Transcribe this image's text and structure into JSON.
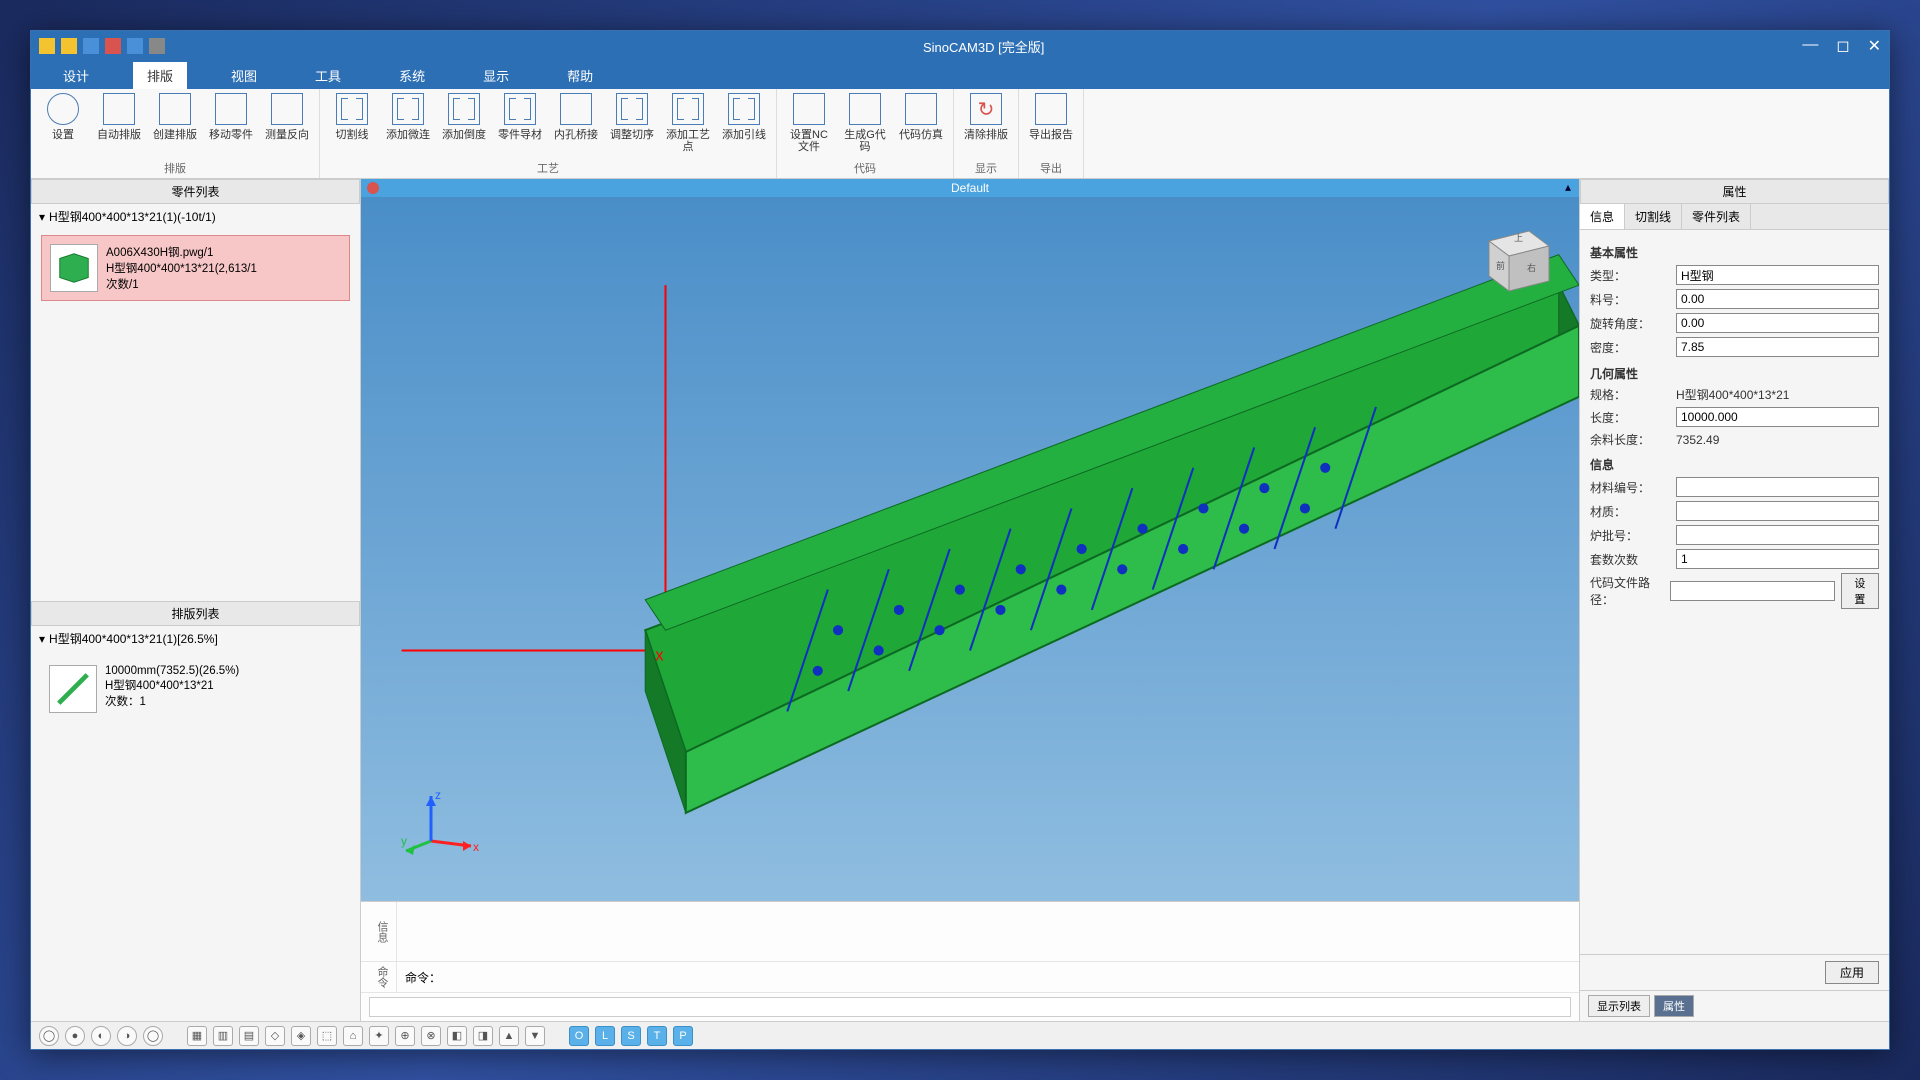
{
  "titlebar": {
    "title": "SinoCAM3D [完全版]"
  },
  "menu": {
    "tabs": [
      "设计",
      "排版",
      "视图",
      "工具",
      "系统",
      "显示",
      "帮助"
    ],
    "active": 1
  },
  "ribbon": {
    "groups": [
      {
        "label": "排版",
        "items": [
          "设置",
          "自动排版",
          "创建排版",
          "移动零件",
          "测量反向"
        ]
      },
      {
        "label": "工艺",
        "items": [
          "切割线",
          "添加微连",
          "添加倒度",
          "零件导材",
          "内孔桥接",
          "调整切序",
          "添加工艺点",
          "添加引线"
        ]
      },
      {
        "label": "代码",
        "items": [
          "设置NC文件",
          "生成G代码",
          "代码仿真"
        ]
      },
      {
        "label": "显示",
        "items": [
          "清除排版"
        ]
      },
      {
        "label": "导出",
        "items": [
          "导出报告"
        ]
      }
    ]
  },
  "leftPanel": {
    "partsHeader": "零件列表",
    "treeRoot": "H型钢400*400*13*21(1)(-10t/1)",
    "partItem": {
      "line1": "A006X430H钢.pwg/1",
      "line2": "H型钢400*400*13*21(2,613/1",
      "line3": "次数/1"
    },
    "nestHeader": "排版列表",
    "nestRoot": "H型钢400*400*13*21(1)[26.5%]",
    "nestItem": {
      "line1": "10000mm(7352.5)(26.5%)",
      "line2": "H型钢400*400*13*21",
      "line3": "次数：1"
    }
  },
  "viewport": {
    "title": "Default"
  },
  "bottomPanel": {
    "label1": "信息",
    "label2": "命令",
    "cmdLabel": "命令："
  },
  "properties": {
    "header": "属性",
    "tabs": [
      "信息",
      "切割线",
      "零件列表"
    ],
    "section1": "基本属性",
    "type": {
      "label": "类型：",
      "value": "H型钢"
    },
    "stock": {
      "label": "料号：",
      "value": "0.00"
    },
    "angle": {
      "label": "旋转角度：",
      "value": "0.00"
    },
    "density": {
      "label": "密度：",
      "value": "7.85"
    },
    "section2": "几何属性",
    "spec": {
      "label": "规格：",
      "value": "H型钢400*400*13*21"
    },
    "length": {
      "label": "长度：",
      "value": "10000.000"
    },
    "remain": {
      "label": "余料长度：",
      "value": "7352.49"
    },
    "section3": "信息",
    "matno": {
      "label": "材料编号：",
      "value": ""
    },
    "material": {
      "label": "材质：",
      "value": ""
    },
    "heatno": {
      "label": "炉批号：",
      "value": ""
    },
    "copies": {
      "label": "套数次数",
      "value": "1"
    },
    "code": {
      "label": "代码文件路径：",
      "value": "",
      "btn": "设置"
    },
    "applyBtn": "应用"
  },
  "footerTabs": {
    "left": "显示列表",
    "right": "属性"
  }
}
